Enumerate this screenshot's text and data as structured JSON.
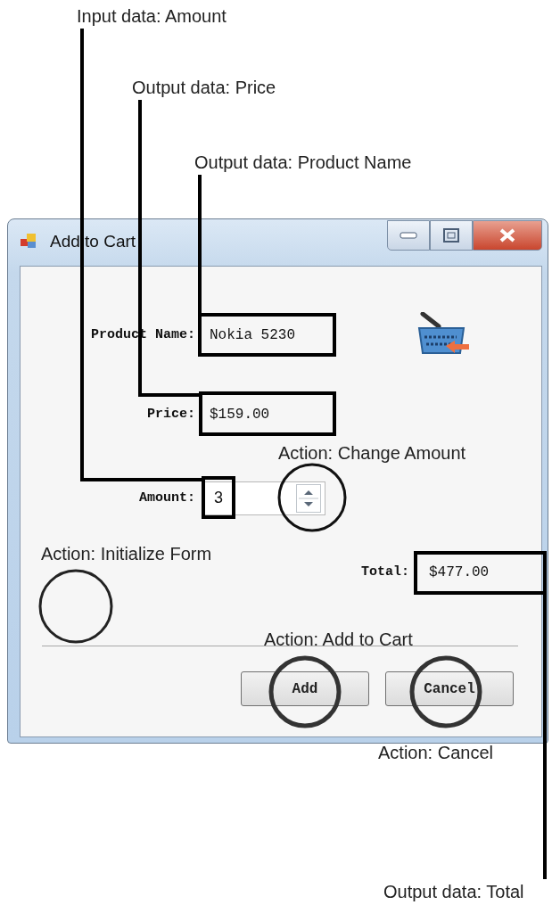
{
  "annotations": [
    {
      "text": "Input data: Amount"
    },
    {
      "text": "Output data: Price"
    },
    {
      "text": "Output data: Product Name"
    },
    {
      "text": "Action: Change Amount"
    },
    {
      "text": "Action: Initialize Form"
    },
    {
      "text": "Action: Add to Cart"
    },
    {
      "text": "Action: Cancel"
    },
    {
      "text": "Output data: Total"
    }
  ],
  "window": {
    "title": "Add to Cart"
  },
  "fields": [
    {
      "label": "Product Name:",
      "value": "Nokia 5230"
    },
    {
      "label": "Price:",
      "value": "$159.00"
    }
  ],
  "amount": {
    "label": "Amount:",
    "value": "3"
  },
  "total": {
    "label": "Total:",
    "value": "$477.00"
  },
  "buttons": [
    "Add",
    "Cancel"
  ]
}
